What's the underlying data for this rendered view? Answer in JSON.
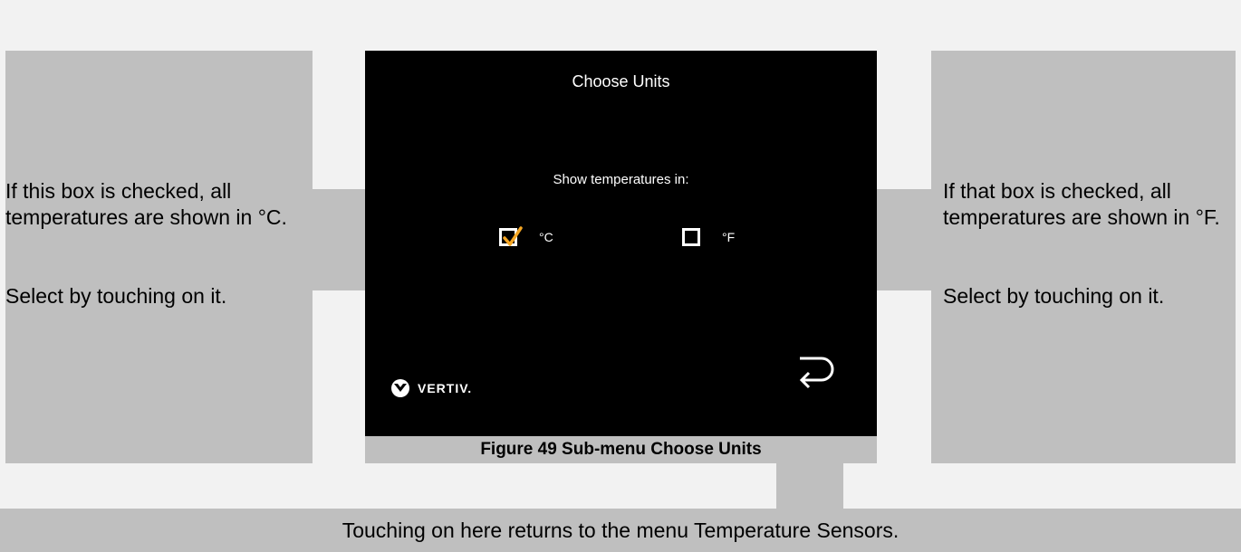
{
  "screen": {
    "title": "Choose Units",
    "prompt": "Show temperatures in:",
    "options": [
      {
        "label": "°C",
        "checked": true
      },
      {
        "label": "°F",
        "checked": false
      }
    ],
    "brand": "VERTIV.",
    "back_icon": "return-arrow-icon"
  },
  "caption": "Figure 49 Sub-menu Choose Units",
  "callouts": {
    "left": {
      "line1": "If this box is checked, all temperatures are shown in °C.",
      "line2": "Select by touching on it."
    },
    "right": {
      "line1": "If that box is checked, all temperatures are shown in °F.",
      "line2": "Select by touching on it."
    },
    "bottom": "Touching on here returns to the menu Temperature Sensors."
  },
  "colors": {
    "callout_bg": "#bfbfbf",
    "screen_bg": "#000000",
    "check_accent": "#f5a623",
    "page_bg": "#f2f2f2"
  }
}
